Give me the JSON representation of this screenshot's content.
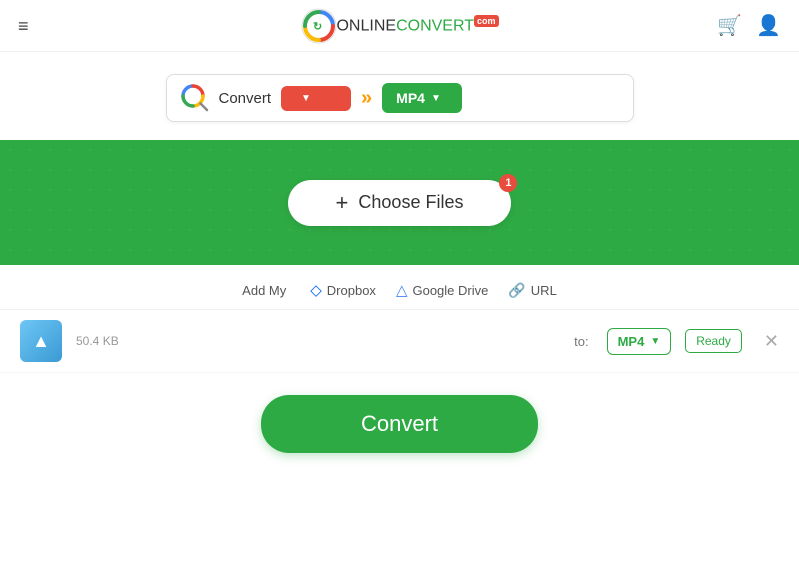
{
  "header": {
    "hamburger": "≡",
    "logo_online": "ONLINE",
    "logo_convert": "CONVERT",
    "logo_com": "com",
    "cart_icon": "🛒",
    "user_icon": "👤"
  },
  "searchbar": {
    "convert_label": "Convert",
    "format_from_placeholder": "",
    "format_to": "MP4",
    "arrow": "»"
  },
  "banner": {
    "choose_files_label": "Choose Files",
    "badge": "1"
  },
  "file_sources": {
    "add_my": "Add My",
    "dropbox": "Dropbox",
    "google_drive": "Google Drive",
    "url": "URL"
  },
  "file_item": {
    "size": "50.4 KB",
    "to_label": "to:",
    "format": "MP4",
    "status": "Ready"
  },
  "convert_button": {
    "label": "Convert"
  }
}
